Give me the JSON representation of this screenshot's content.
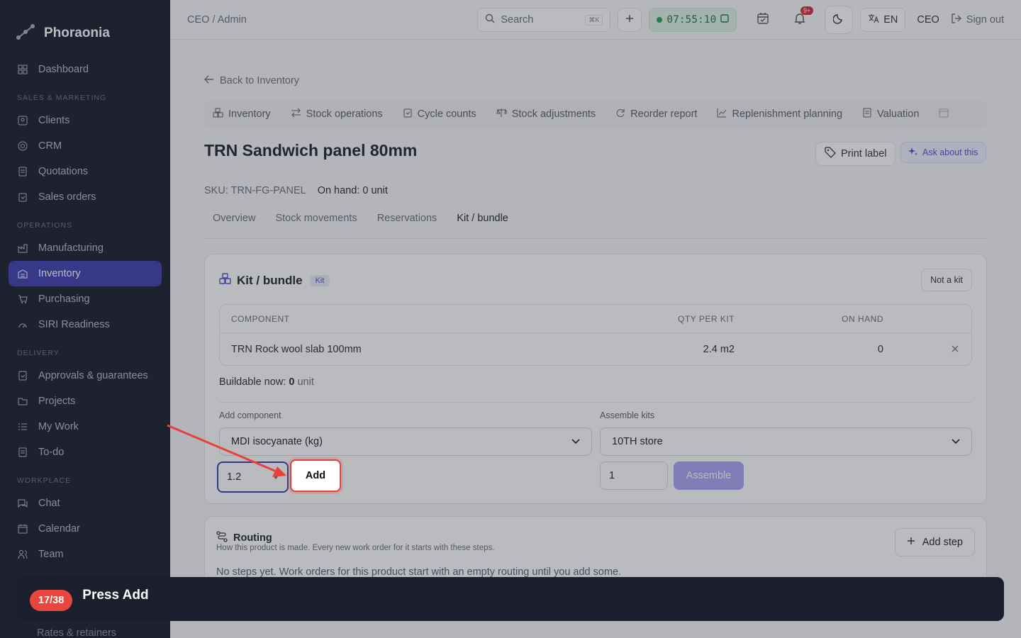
{
  "brand": {
    "name": "Phoraonia"
  },
  "sidebar": {
    "dashboard": "Dashboard",
    "sections": {
      "sales": "SALES & MARKETING",
      "operations": "OPERATIONS",
      "delivery": "DELIVERY",
      "workplace": "WORKPLACE"
    },
    "items": {
      "clients": "Clients",
      "crm": "CRM",
      "quotations": "Quotations",
      "sales_orders": "Sales orders",
      "manufacturing": "Manufacturing",
      "inventory": "Inventory",
      "purchasing": "Purchasing",
      "siri": "SIRI Readiness",
      "approvals": "Approvals & guarantees",
      "projects": "Projects",
      "my_work": "My Work",
      "todo": "To-do",
      "chat": "Chat",
      "calendar": "Calendar",
      "team": "Team",
      "rates": "Rates & retainers"
    }
  },
  "topbar": {
    "breadcrumb": "CEO / Admin",
    "search_placeholder": "Search",
    "search_shortcut": "⌘K",
    "timer": "07:55:10",
    "notifications_badge": "9+",
    "language": "EN",
    "role": "CEO",
    "signout": "Sign out"
  },
  "page": {
    "back": "Back to Inventory",
    "subnav": {
      "inventory": "Inventory",
      "stock_operations": "Stock operations",
      "cycle_counts": "Cycle counts",
      "stock_adjustments": "Stock adjustments",
      "reorder_report": "Reorder report",
      "replenishment": "Replenishment planning",
      "valuation": "Valuation"
    },
    "title": "TRN Sandwich panel 80mm",
    "print_label": "Print label",
    "ask_about": "Ask about this",
    "sku": "SKU: TRN-FG-PANEL",
    "on_hand": "On hand: 0 unit",
    "tabs": {
      "overview": "Overview",
      "stock_movements": "Stock movements",
      "reservations": "Reservations",
      "kit": "Kit / bundle"
    }
  },
  "kit_card": {
    "title": "Kit / bundle",
    "pill": "Kit",
    "not_a_kit": "Not a kit",
    "columns": {
      "component": "COMPONENT",
      "qty": "QTY PER KIT",
      "on_hand": "ON HAND"
    },
    "rows": [
      {
        "component": "TRN Rock wool slab 100mm",
        "qty": "2.4 m2",
        "on_hand": "0"
      }
    ],
    "buildable_label": "Buildable now:",
    "buildable_value": "0",
    "buildable_unit": "unit",
    "add_component_label": "Add component",
    "component_select": "MDI isocyanate (kg)",
    "qty_value": "1.2",
    "add_button": "Add",
    "assemble_label": "Assemble kits",
    "store_select": "10TH store",
    "assemble_qty": "1",
    "assemble_button": "Assemble"
  },
  "routing": {
    "title": "Routing",
    "subtitle": "How this product is made. Every new work order for it starts with these steps.",
    "add_step": "Add step",
    "empty": "No steps yet. Work orders for this product start with an empty routing until you add some."
  },
  "tutorial": {
    "step": "17/38",
    "instruction": "Press Add"
  },
  "colors": {
    "sidebar_bg": "#1a1d2b",
    "active_nav": "#3f3fae",
    "highlight": "#e9403b",
    "assemble": "#a9a3f2"
  }
}
